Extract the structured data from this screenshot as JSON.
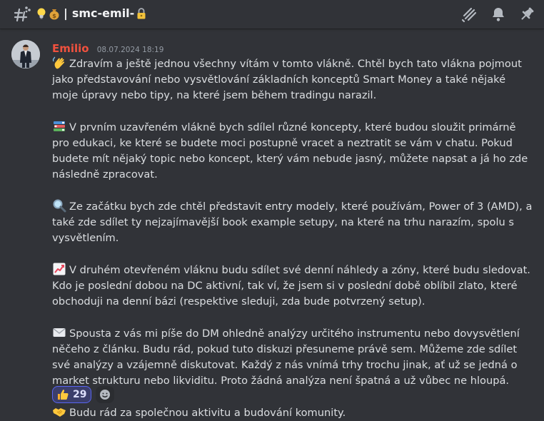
{
  "channel": {
    "name": "smc-emil-",
    "separator": "|",
    "icons": [
      "thread-hash-icon",
      "lightbulb-emoji",
      "money-bag-emoji",
      "lock-emoji"
    ]
  },
  "header_actions": [
    "threads-icon",
    "bell-icon",
    "pin-icon"
  ],
  "message": {
    "author": "Emilio",
    "author_color": "#f0513e",
    "timestamp": "08.07.2024 18:19",
    "paragraphs": [
      {
        "emoji": "waving-hand",
        "text": "Zdravím a ještě jednou všechny vítám v tomto vlákně. Chtěl bych tato vlákna pojmout jako představování nebo vysvětlování základních konceptů Smart Money a také nějaké moje úpravy nebo tipy, na které jsem během tradingu narazil."
      },
      {
        "emoji": "books",
        "text": "V prvním uzavřeném vlákně bych sdílel různé koncepty, které budou sloužit primárně pro edukaci, ke které se budete moci postupně vracet a neztratit se vám v chatu. Pokud budete mít nějaký topic nebo koncept, který vám nebude jasný, můžete napsat a já ho zde následně zpracovat."
      },
      {
        "emoji": "magnifying-glass",
        "text": "Ze začátku bych zde chtěl představit entry modely, které používám, Power of 3 (AMD), a také zde sdílet ty nejzajímavější book example setupy, na které na trhu narazím, spolu s vysvětlením."
      },
      {
        "emoji": "chart-increasing",
        "text": "V druhém otevřeném vláknu budu sdílet své denní náhledy a zóny, které budu sledovat. Kdo je poslední dobou na DC aktivní, tak ví, že jsem si v poslední době oblíbil zlato, které obchoduji na denní bázi (respektive sleduji, zda bude potvrzený setup)."
      },
      {
        "emoji": "envelope",
        "text": "Spousta z vás mi píše do DM ohledně analýzy určitého instrumentu nebo dovysvětlení něčeho z článku. Budu rád, pokud tuto diskuzi přesuneme právě sem. Můžeme zde sdílet své analýzy a vzájemně diskutovat. Každý z nás vnímá trhy trochu jinak, ať už se jedná o market strukturu nebo likviditu. Proto žádná analýza není špatná a už vůbec ne hloupá."
      },
      {
        "emoji": "handshake",
        "text": "Budu rád za společnou aktivitu a budování komunity."
      }
    ]
  },
  "reactions": [
    {
      "emoji": "thumbs-up",
      "count": "29",
      "active": true
    }
  ],
  "add_reaction_icon": "add-reaction-icon"
}
